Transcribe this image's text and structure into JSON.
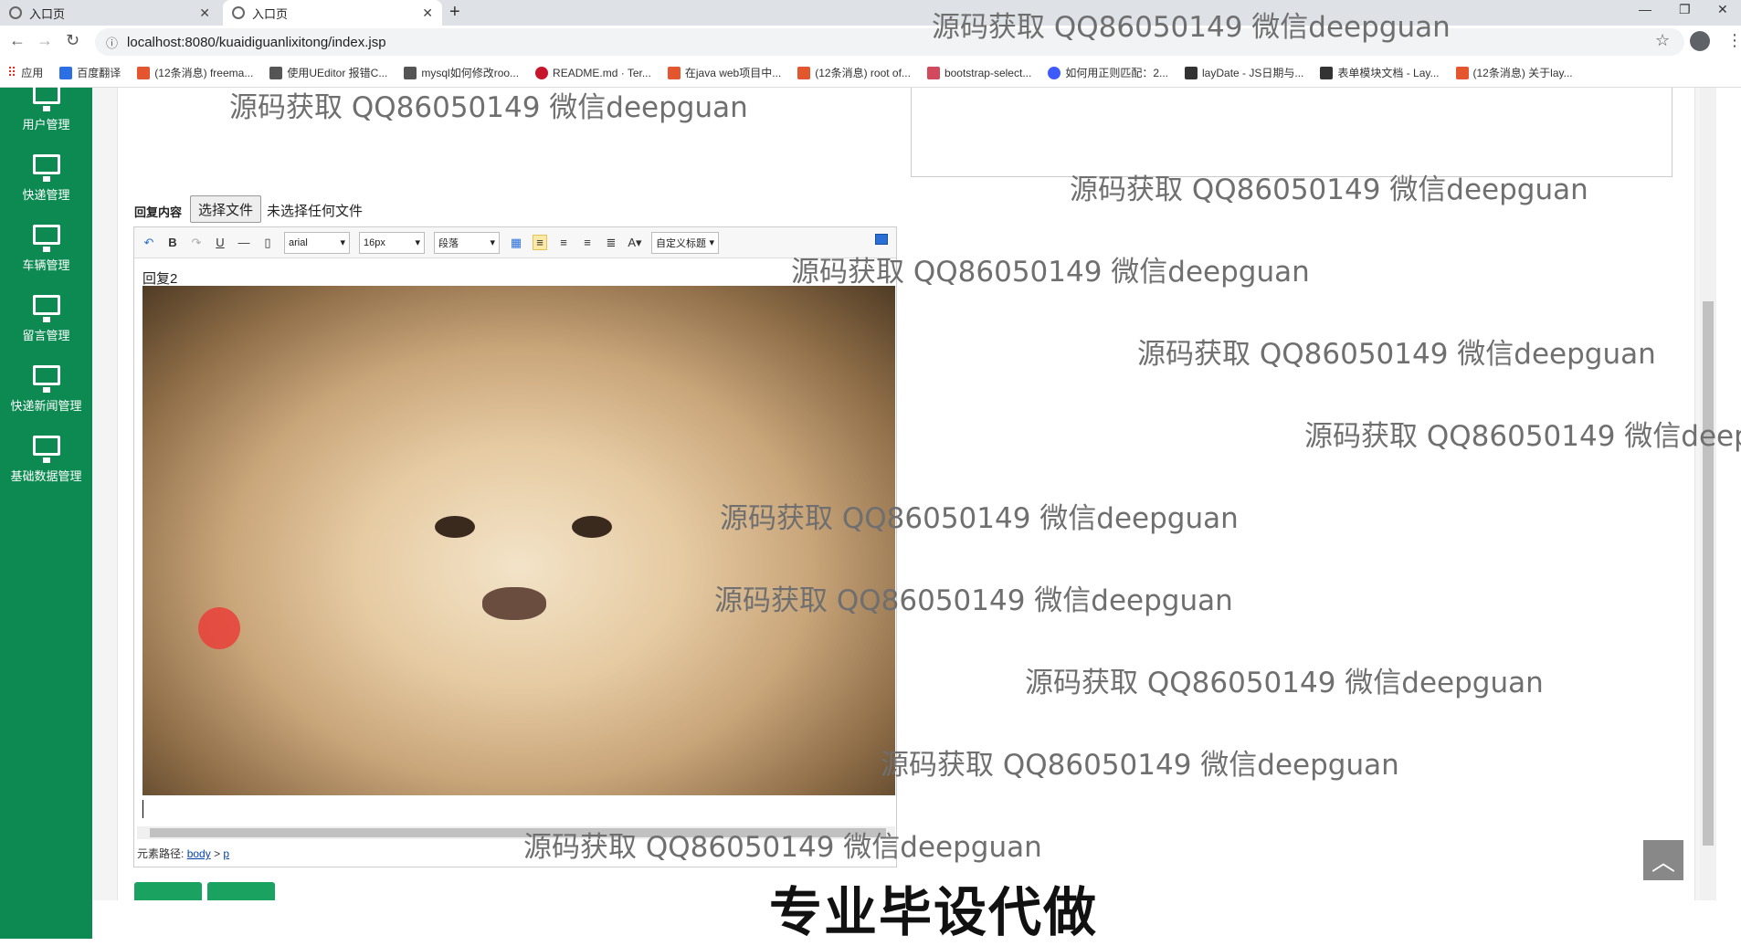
{
  "browser": {
    "tabs": [
      {
        "title": "入口页"
      },
      {
        "title": "入口页"
      }
    ],
    "url": "localhost:8080/kuaidiguanlixitong/index.jsp",
    "bookmarks": [
      {
        "label": "应用",
        "color": "#d93025"
      },
      {
        "label": "百度翻译",
        "color": "#2c6ee5"
      },
      {
        "label": "(12条消息) freema...",
        "color": "#e4572e"
      },
      {
        "label": "使用UEditor 报错C...",
        "color": "#555555"
      },
      {
        "label": "mysql如何修改roo...",
        "color": "#555555"
      },
      {
        "label": "README.md · Ter...",
        "color": "#c7162b"
      },
      {
        "label": "在java web项目中...",
        "color": "#e4572e"
      },
      {
        "label": "(12条消息) root of...",
        "color": "#e4572e"
      },
      {
        "label": "bootstrap-select...",
        "color": "#d2495e"
      },
      {
        "label": "如何用正则匹配：2...",
        "color": "#3d5afe"
      },
      {
        "label": "layDate - JS日期与...",
        "color": "#333333"
      },
      {
        "label": "表单模块文档 - Lay...",
        "color": "#333333"
      },
      {
        "label": "(12条消息) 关于lay...",
        "color": "#e4572e"
      }
    ]
  },
  "sidebar": {
    "items": [
      {
        "label": "用户管理"
      },
      {
        "label": "快递管理"
      },
      {
        "label": "车辆管理"
      },
      {
        "label": "留言管理"
      },
      {
        "label": "快递新闻管理"
      },
      {
        "label": "基础数据管理"
      }
    ]
  },
  "form": {
    "reply_label": "回复内容",
    "file_button": "选择文件",
    "file_status": "未选择任何文件"
  },
  "editor": {
    "font_family": "arial",
    "font_size": "16px",
    "paragraph": "段落",
    "custom_title": "自定义标题",
    "content_text": "回复2",
    "element_path_label": "元素路径:",
    "path_body": "body",
    "path_sep": ">",
    "path_p": "p"
  },
  "watermarks": {
    "text": "源码获取 QQ86050149 微信deepguan",
    "text_clipped": "源码获取 QQ86050149 微信deepg",
    "banner": "专业毕设代做"
  },
  "colors": {
    "sidebar_bg": "#0d8a52",
    "button_green": "#1aa260"
  }
}
